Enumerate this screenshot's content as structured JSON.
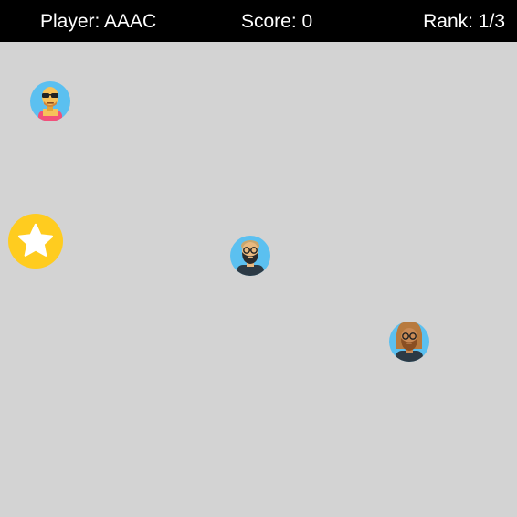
{
  "hud": {
    "player_text": "Player: AAAC",
    "score_text": "Score: 0",
    "rank_text": "Rank: 1/3"
  },
  "colors": {
    "hud_background": "#000000",
    "hud_text": "#ffffff",
    "field_background": "#d3d3d3",
    "avatar_ring": "#5bc0f0",
    "star_orb": "#ffcc1f"
  },
  "entities": {
    "avatars": [
      {
        "icon": "bald-sunglasses-avatar-icon"
      },
      {
        "icon": "bearded-glasses-avatar-icon"
      },
      {
        "icon": "long-hair-glasses-avatar-icon"
      }
    ],
    "powerup": {
      "icon": "star-icon"
    }
  }
}
